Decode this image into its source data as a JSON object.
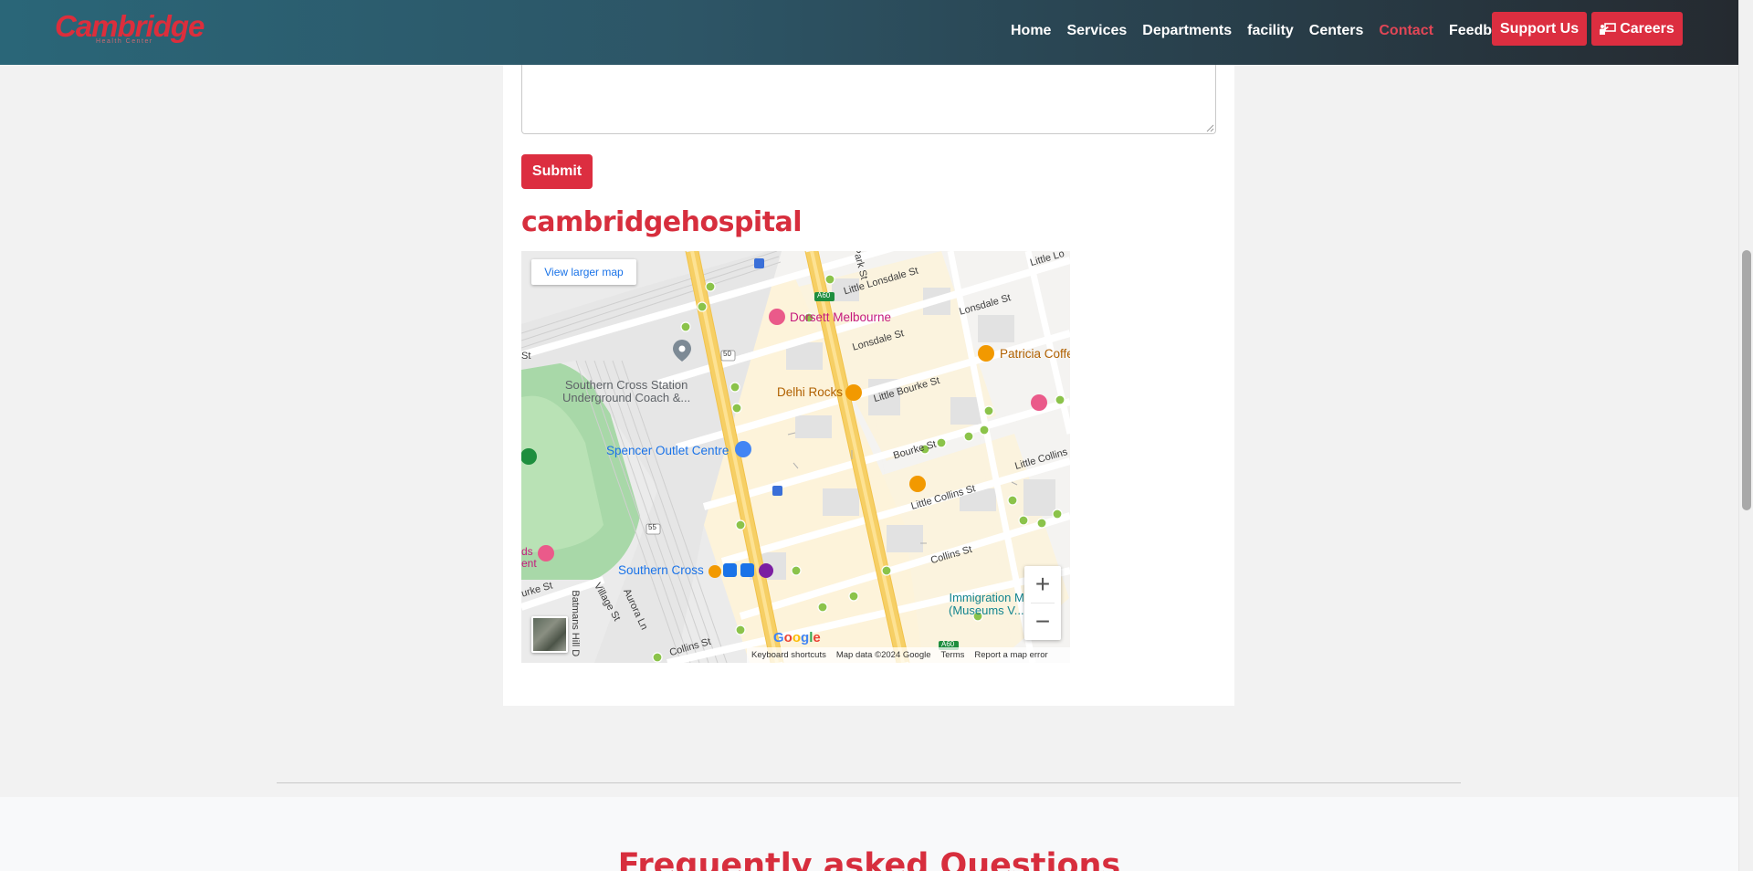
{
  "brand": {
    "logo_text": "Cambridge",
    "logo_sub": "Health Center",
    "colors": {
      "accent": "#dc2e40",
      "nav_active": "#e14656",
      "heading": "#d72e3d"
    }
  },
  "nav": {
    "links": [
      "Home",
      "Services",
      "Departments",
      "facility",
      "Centers",
      "Contact",
      "Feedback"
    ],
    "active": "Contact",
    "support_label": "Support Us",
    "careers_label": "Careers",
    "careers_icon": "person-chalkboard-icon"
  },
  "form": {
    "message_value": "",
    "submit_label": "Submit"
  },
  "map_section": {
    "heading": "cambridgehospital",
    "view_larger": "View larger map",
    "zoom_in": "+",
    "zoom_out": "−",
    "google": "Google",
    "attribution": {
      "shortcuts": "Keyboard shortcuts",
      "data": "Map data ©2024 Google",
      "terms": "Terms",
      "report": "Report a map error"
    },
    "places": {
      "dorsett": "Dorsett Melbourne",
      "patricia": "Patricia Coffe",
      "southern_cross_station": "Southern Cross Station\nUnderground Coach &...",
      "delhi": "Delhi Rocks",
      "spencer": "Spencer Outlet Centre",
      "southern_cross": "Southern Cross",
      "immigration": "Immigration M...\n(Museums V...a)"
    },
    "streets": {
      "little_lonsdale": "Little Lonsdale St",
      "lonsdale_1": "Lonsdale St",
      "lonsdale_2": "Lonsdale St",
      "little_bourke": "Little Bourke St",
      "bourke_1": "Bourke St",
      "bourke_2": "urke St",
      "little_collins_1": "Little Collins St",
      "little_collins_2": "Little Collins",
      "collins_1": "Collins St",
      "collins_2": "Collins St",
      "village": "Village St",
      "aurora": "Aurora Ln",
      "batmans": "Batmans Hill D",
      "st_left": "St",
      "park": "Park St",
      "little_lo": "Little Lo",
      "ds": "ds\nent",
      "route_50": "50",
      "route_55": "55",
      "route_a60_1": "A60",
      "route_a60_2": "A60"
    }
  },
  "faq": {
    "title": "Frequently asked Questions"
  }
}
